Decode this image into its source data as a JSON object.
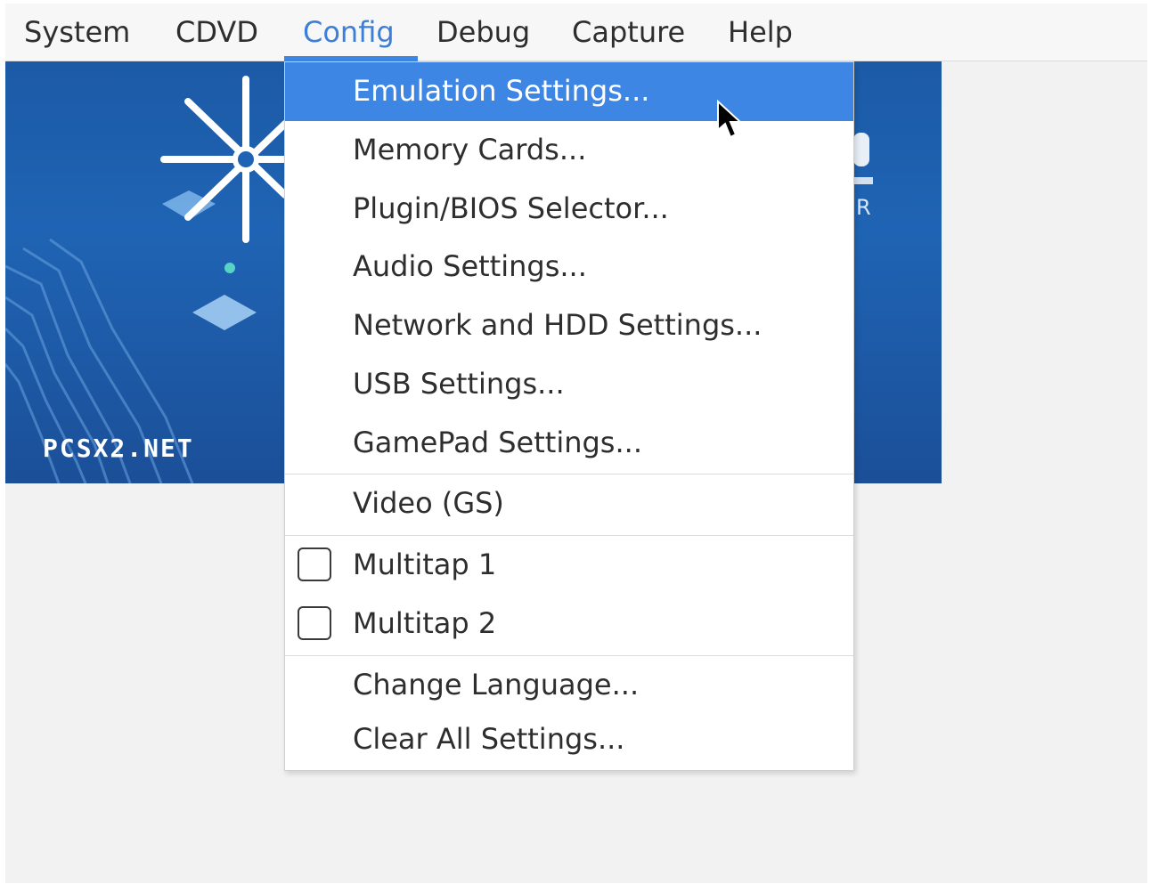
{
  "menubar": {
    "items": [
      {
        "label": "System"
      },
      {
        "label": "CDVD"
      },
      {
        "label": "Config"
      },
      {
        "label": "Debug"
      },
      {
        "label": "Capture"
      },
      {
        "label": "Help"
      }
    ],
    "active": "Config"
  },
  "banner": {
    "url_text": "PCSX2.NET",
    "partial_letter": "R"
  },
  "config_menu": {
    "items": [
      {
        "label": "Emulation Settings...",
        "highlighted": true
      },
      {
        "label": "Memory Cards..."
      },
      {
        "label": "Plugin/BIOS Selector..."
      },
      {
        "label": "Audio Settings..."
      },
      {
        "label": "Network and HDD Settings..."
      },
      {
        "label": "USB Settings..."
      },
      {
        "label": "GamePad Settings..."
      },
      {
        "label": "Video (GS)"
      },
      {
        "label": "Multitap 1",
        "checked": false
      },
      {
        "label": "Multitap 2",
        "checked": false
      },
      {
        "label": "Change Language..."
      },
      {
        "label": "Clear All Settings..."
      }
    ]
  },
  "colors": {
    "accent": "#3d86e3",
    "banner_blue": "#1f64b4"
  },
  "icons": {
    "pointer": "mouse-pointer-icon",
    "logo": "pcsx2-star-logo-icon"
  }
}
